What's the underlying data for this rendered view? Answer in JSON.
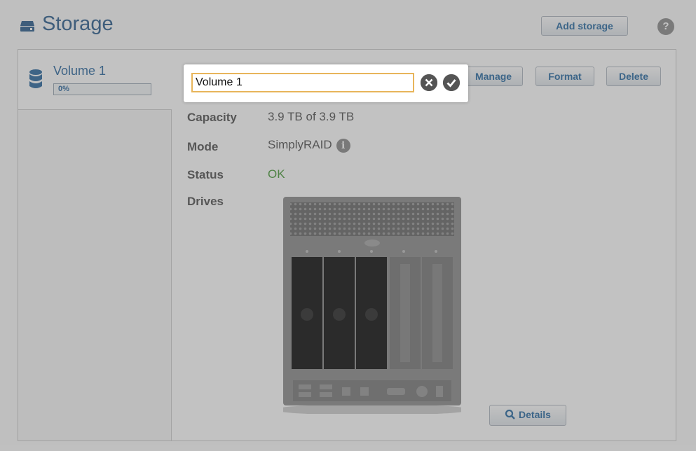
{
  "header": {
    "title": "Storage",
    "title_icon": "drive-icon",
    "add_storage_label": "Add storage",
    "help_icon": "help-icon",
    "help_glyph": "?"
  },
  "sidebar": {
    "volume": {
      "name": "Volume 1",
      "usage_text": "0%",
      "usage_fraction": 0.0,
      "icon": "database-icon"
    }
  },
  "toolbar": {
    "manage_label": "Manage",
    "format_label": "Format",
    "delete_label": "Delete"
  },
  "volume_info": {
    "capacity_label": "Capacity",
    "capacity_value": "3.9 TB of 3.9 TB",
    "mode_label": "Mode",
    "mode_value": "SimplyRAID",
    "status_label": "Status",
    "status_value": "OK",
    "status_color": "#4a9a3a",
    "drives_label": "Drives",
    "info_glyph": "i"
  },
  "drives_image": {
    "bays": [
      {
        "occupied": true
      },
      {
        "occupied": true
      },
      {
        "occupied": true
      },
      {
        "occupied": false
      },
      {
        "occupied": false
      }
    ]
  },
  "details_button": {
    "label": "Details",
    "icon": "magnifier-icon"
  },
  "rename_popup": {
    "value": "Volume 1",
    "cancel_icon": "close-circle-icon",
    "confirm_icon": "check-circle-icon"
  },
  "colors": {
    "accent": "#2f6aa0",
    "input_border": "#e8b55b"
  }
}
